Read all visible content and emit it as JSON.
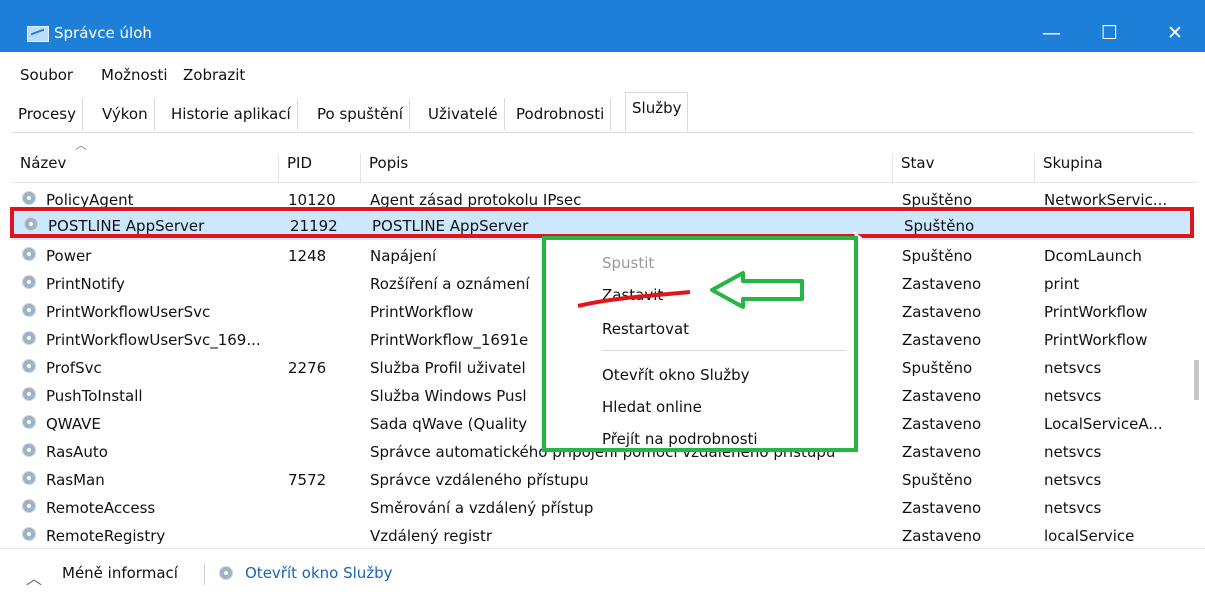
{
  "window": {
    "title": "Správce úloh",
    "controls": [
      "—",
      "☐",
      "✕"
    ]
  },
  "menu": [
    "Soubor",
    "Možnosti",
    "Zobrazit"
  ],
  "tabs": [
    "Procesy",
    "Výkon",
    "Historie aplikací",
    "Po spuštění",
    "Uživatelé",
    "Podrobnosti",
    "Služby"
  ],
  "active_tab": "Služby",
  "columns": [
    "Název",
    "PID",
    "Popis",
    "Stav",
    "Skupina"
  ],
  "rows": [
    {
      "name": "PolicyAgent",
      "pid": "10120",
      "desc": "Agent zásad protokolu IPsec",
      "status": "Spuštěno",
      "group": "NetworkServic..."
    },
    {
      "name": "POSTLINE AppServer",
      "pid": "21192",
      "desc": "POSTLINE AppServer",
      "status": "Spuštěno",
      "group": ""
    },
    {
      "name": "Power",
      "pid": "1248",
      "desc": "Napájení",
      "status": "Spuštěno",
      "group": "DcomLaunch"
    },
    {
      "name": "PrintNotify",
      "pid": "",
      "desc": "Rozšíření a oznámení",
      "status": "Zastaveno",
      "group": "print"
    },
    {
      "name": "PrintWorkflowUserSvc",
      "pid": "",
      "desc": "PrintWorkflow",
      "status": "Zastaveno",
      "group": "PrintWorkflow"
    },
    {
      "name": "PrintWorkflowUserSvc_169...",
      "pid": "",
      "desc": "PrintWorkflow_1691e",
      "status": "Zastaveno",
      "group": "PrintWorkflow"
    },
    {
      "name": "ProfSvc",
      "pid": "2276",
      "desc": "Služba Profil uživatel",
      "status": "Spuštěno",
      "group": "netsvcs"
    },
    {
      "name": "PushToInstall",
      "pid": "",
      "desc": "Služba Windows Pusl",
      "status": "Zastaveno",
      "group": "netsvcs"
    },
    {
      "name": "QWAVE",
      "pid": "",
      "desc": "Sada qWave (Quality",
      "status": "Zastaveno",
      "group": "LocalServiceA..."
    },
    {
      "name": "RasAuto",
      "pid": "",
      "desc": "Správce automatického připojení pomocí vzdáleného přístupu",
      "status": "Zastaveno",
      "group": "netsvcs"
    },
    {
      "name": "RasMan",
      "pid": "7572",
      "desc": "Správce vzdáleného přístupu",
      "status": "Spuštěno",
      "group": "netsvcs"
    },
    {
      "name": "RemoteAccess",
      "pid": "",
      "desc": "Směrování a vzdálený přístup",
      "status": "Zastaveno",
      "group": "netsvcs"
    },
    {
      "name": "RemoteRegistry",
      "pid": "",
      "desc": "Vzdálený registr",
      "status": "Zastaveno",
      "group": "localService"
    }
  ],
  "context_menu": {
    "items": [
      "Spustit",
      "Zastavit",
      "Restartovat",
      "Otevřít okno Služby",
      "Hledat online",
      "Přejít na podrobnosti"
    ],
    "disabled": [
      "Spustit"
    ]
  },
  "footer": {
    "less_info": "Méně informací",
    "open_services": "Otevřít okno Služby"
  },
  "colors": {
    "titlebar": "#1e7fd8",
    "selected_row": "#cce8ff",
    "highlight_red": "#e0151b",
    "highlight_green": "#27b543"
  },
  "icons": {
    "service": "gear-icon",
    "sort": "sort-up-icon"
  }
}
